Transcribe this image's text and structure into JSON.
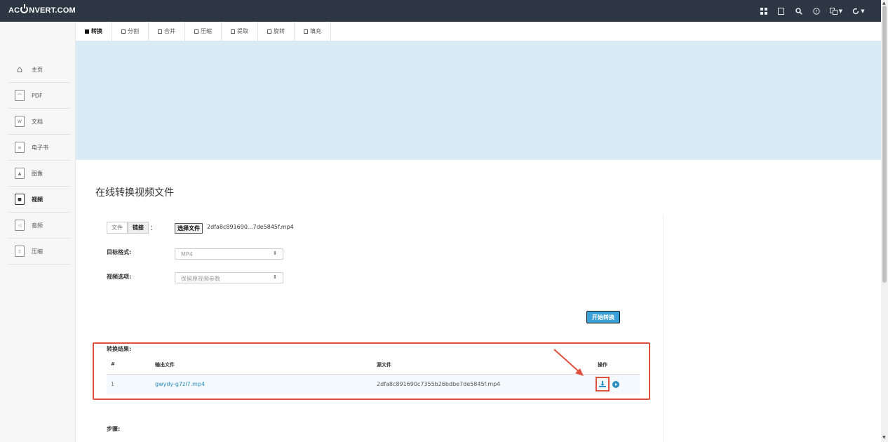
{
  "topbar": {
    "logo_prefix": "AC",
    "logo_suffix": "NVERT.COM",
    "icons": [
      "grid-icon",
      "bookmark-icon",
      "search-icon",
      "help-icon",
      "language-icon",
      "refresh-icon"
    ]
  },
  "tabs": [
    {
      "label": "转换",
      "active": true
    },
    {
      "label": "分割"
    },
    {
      "label": "合并"
    },
    {
      "label": "压缩"
    },
    {
      "label": "提取"
    },
    {
      "label": "旋转"
    },
    {
      "label": "填充"
    }
  ],
  "sidebar": {
    "items": [
      {
        "label": "主页"
      },
      {
        "label": "PDF"
      },
      {
        "label": "文档"
      },
      {
        "label": "电子书"
      },
      {
        "label": "图像"
      },
      {
        "label": "视频",
        "active": true
      },
      {
        "label": "音频"
      },
      {
        "label": "压缩"
      }
    ]
  },
  "main": {
    "title": "在线转换视频文件",
    "source_toggle": {
      "file": "文件",
      "link": "链接"
    },
    "colon": "：",
    "choose_file_label": "选择文件",
    "file_name": "2dfa8c891690...7de5845f.mp4",
    "target_format_label": "目标格式:",
    "target_format_value": "MP4",
    "video_options_label": "视频选项:",
    "video_options_value": "保留原视频参数",
    "start_button": "开始转换",
    "result": {
      "label": "转换结果:",
      "columns": [
        "#",
        "输出文件",
        "源文件",
        "操作"
      ],
      "rows": [
        {
          "index": "1",
          "output": "gwydy-g7zi7.mp4",
          "source": "2dfa8c891690c7355b26bdbe7de5845f.mp4"
        }
      ]
    },
    "steps_label": "步骤:"
  },
  "colors": {
    "topbar": "#2d3643",
    "banner": "#d9ebf5",
    "accent": "#2b8fc4",
    "highlight": "#e0503e"
  }
}
